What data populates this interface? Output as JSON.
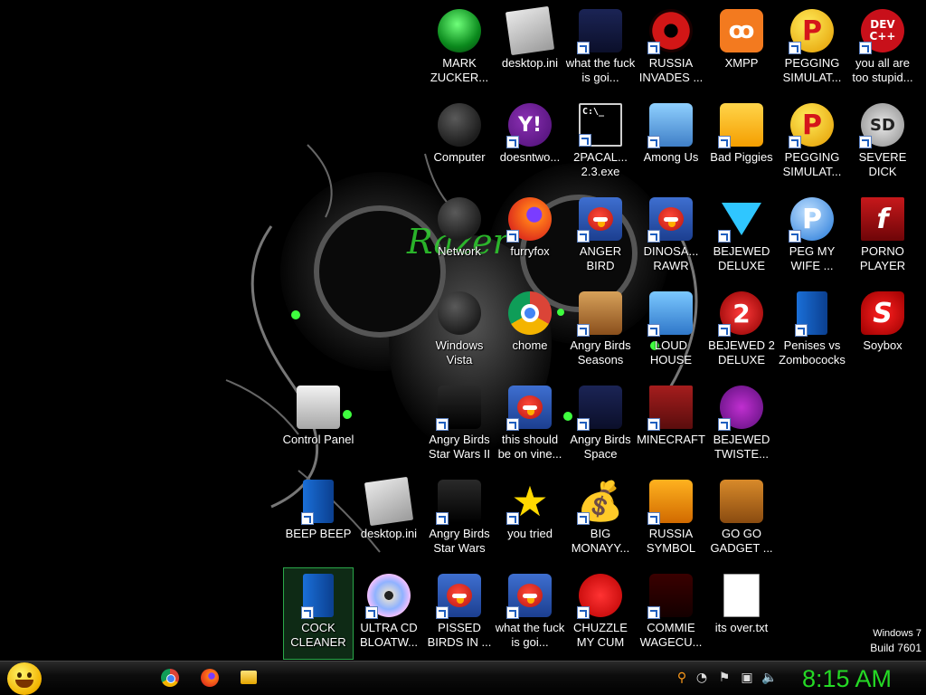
{
  "desktop": {
    "icons": [
      {
        "label": "MARK ZUCKER...",
        "look": "ic-green",
        "glyph": ""
      },
      {
        "label": "desktop.ini",
        "look": "ic-doc",
        "glyph": ""
      },
      {
        "label": "what the fuck is goi...",
        "look": "ic-space",
        "glyph": ""
      },
      {
        "label": "RUSSIA INVADES ...",
        "look": "ic-radiation",
        "glyph": ""
      },
      {
        "label": "XMPP",
        "look": "ic-xampp",
        "glyph": "ꝏ"
      },
      {
        "label": "PEGGING SIMULAT...",
        "look": "ic-peg",
        "glyph": "P"
      },
      {
        "label": "you all are too stupid...",
        "look": "ic-dev",
        "glyph": "DEV C++"
      },
      {
        "label": "Computer",
        "look": "ic-globe",
        "glyph": ""
      },
      {
        "label": "doesntwo...",
        "look": "ic-yahoo",
        "glyph": "Y!"
      },
      {
        "label": "2PACAL... 2.3.exe",
        "look": "ic-cmd",
        "glyph": "C:\\_"
      },
      {
        "label": "Among Us",
        "look": "ic-among",
        "glyph": ""
      },
      {
        "label": "Bad Piggies",
        "look": "ic-piggies",
        "glyph": ""
      },
      {
        "label": "PEGGING SIMULAT...",
        "look": "ic-peg",
        "glyph": "P"
      },
      {
        "label": "SEVERE DICK",
        "look": "ic-sd",
        "glyph": "SD"
      },
      {
        "label": "Network",
        "look": "ic-globe",
        "glyph": ""
      },
      {
        "label": "furryfox",
        "look": "ic-fox",
        "glyph": ""
      },
      {
        "label": "ANGER BIRD",
        "look": "ic-angry",
        "glyph": ""
      },
      {
        "label": "DINOSA... RAWR",
        "look": "ic-angry",
        "glyph": ""
      },
      {
        "label": "BEJEWED DELUXE",
        "look": "ic-gem",
        "glyph": ""
      },
      {
        "label": "PEG MY WIFE ...",
        "look": "ic-pegw",
        "glyph": "P"
      },
      {
        "label": "PORNO PLAYER",
        "look": "ic-flash",
        "glyph": "f"
      },
      {
        "label": "Windows Vista",
        "look": "ic-globe",
        "glyph": ""
      },
      {
        "label": "chome",
        "look": "ic-chrome",
        "glyph": ""
      },
      {
        "label": "Angry Birds Seasons",
        "look": "ic-seasons",
        "glyph": ""
      },
      {
        "label": "LOUD HOUSE",
        "look": "ic-loud",
        "glyph": ""
      },
      {
        "label": "BEJEWED 2 DELUXE",
        "look": "ic-bej2",
        "glyph": "2"
      },
      {
        "label": "Penises vs Zombococks",
        "look": "ic-blue",
        "glyph": ""
      },
      {
        "label": "Soybox",
        "look": "ic-soy",
        "glyph": "S"
      },
      {
        "label": "Control Panel",
        "look": "ic-cpanel",
        "glyph": ""
      },
      {
        "label": "Angry Birds Star Wars II",
        "look": "ic-starwars",
        "glyph": ""
      },
      {
        "label": "this should be on vine...",
        "look": "ic-angry",
        "glyph": ""
      },
      {
        "label": "Angry Birds Space",
        "look": "ic-space",
        "glyph": ""
      },
      {
        "label": "MINECRAFT",
        "look": "ic-minecraft",
        "glyph": ""
      },
      {
        "label": "BEJEWED TWISTE...",
        "look": "ic-twist",
        "glyph": ""
      },
      {
        "label": "BEEP BEEP",
        "look": "ic-blue",
        "glyph": ""
      },
      {
        "label": "desktop.ini",
        "look": "ic-doc",
        "glyph": ""
      },
      {
        "label": "Angry Birds Star Wars",
        "look": "ic-starwars",
        "glyph": ""
      },
      {
        "label": "you tried",
        "look": "ic-star",
        "glyph": "★"
      },
      {
        "label": "BIG MONAYY...",
        "look": "ic-bag",
        "glyph": "💰"
      },
      {
        "label": "RUSSIA SYMBOL",
        "look": "ic-russia",
        "glyph": ""
      },
      {
        "label": "GO GO GADGET ...",
        "look": "ic-gadget",
        "glyph": ""
      },
      {
        "label": "COCK CLEANER",
        "look": "ic-blue",
        "glyph": ""
      },
      {
        "label": "ULTRA CD BLOATW...",
        "look": "ic-cd",
        "glyph": ""
      },
      {
        "label": "PISSED BIRDS IN ...",
        "look": "ic-angry",
        "glyph": ""
      },
      {
        "label": "what the fuck is goi...",
        "look": "ic-angry",
        "glyph": ""
      },
      {
        "label": "CHUZZLE MY CUM",
        "look": "ic-chuzzle",
        "glyph": ""
      },
      {
        "label": "COMMIE WAGECU...",
        "look": "ic-commie",
        "glyph": ""
      },
      {
        "label": "its over.txt",
        "look": "ic-txt",
        "glyph": ""
      }
    ]
  },
  "watermark": {
    "line1": "Windows 7",
    "line2": "Build 7601"
  },
  "taskbar": {
    "clock": "8:15 AM",
    "pinned": [
      "chrome-icon",
      "firefox-icon",
      "file-explorer-icon"
    ]
  },
  "colors": {
    "clock": "#25d925",
    "selection": "#2aa84a"
  }
}
